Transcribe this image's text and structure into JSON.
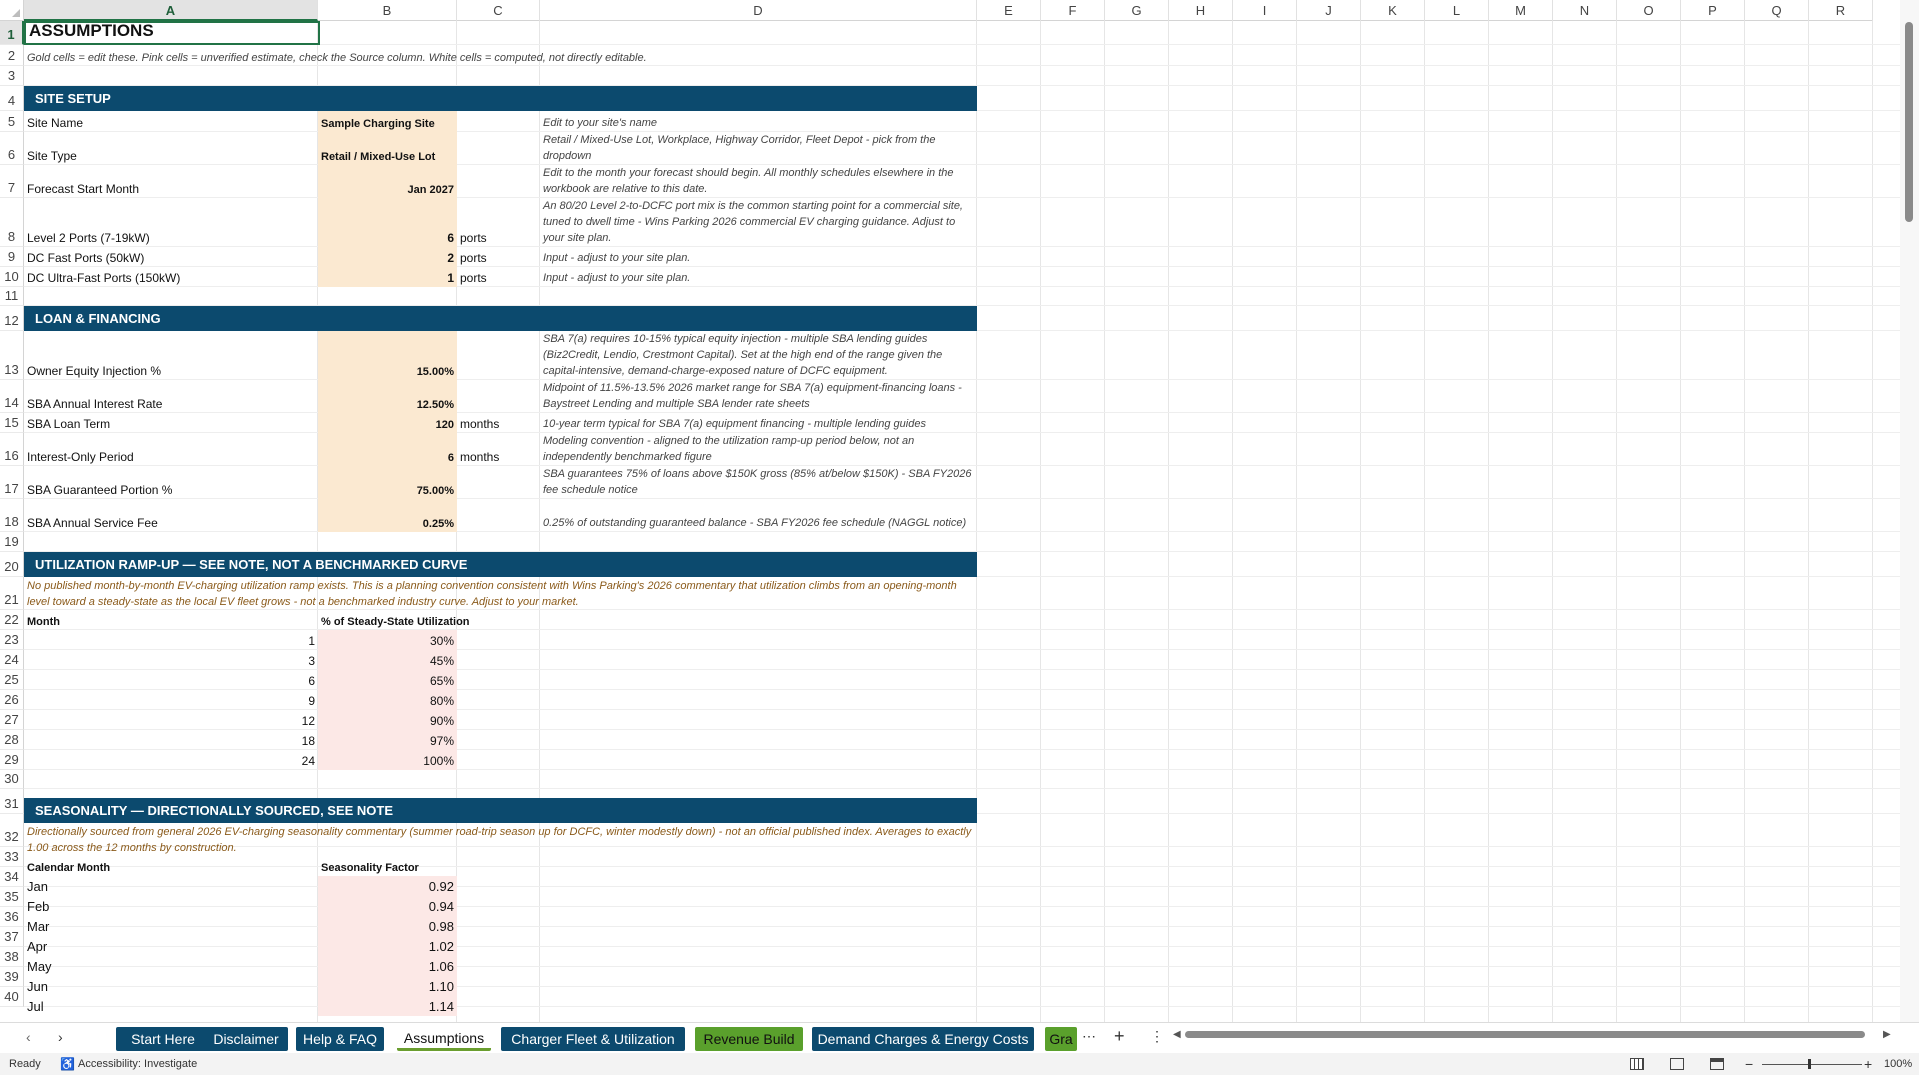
{
  "columns": [
    "A",
    "B",
    "C",
    "D",
    "E",
    "F",
    "G",
    "H",
    "I",
    "J",
    "K",
    "L",
    "M",
    "N",
    "O",
    "P",
    "Q",
    "R"
  ],
  "rows": [
    "1",
    "2",
    "3",
    "4",
    "5",
    "6",
    "7",
    "8",
    "9",
    "10",
    "11",
    "12",
    "13",
    "14",
    "15",
    "16",
    "17",
    "18",
    "19",
    "20",
    "21",
    "22",
    "23",
    "24",
    "25",
    "26",
    "27",
    "28",
    "29",
    "30",
    "31",
    "32",
    "33",
    "34",
    "35",
    "36",
    "37",
    "38",
    "39",
    "40"
  ],
  "title": "ASSUMPTIONS",
  "subtitle": "Gold cells = edit these. Pink cells = unverified estimate, check the Source column. White cells = computed, not directly editable.",
  "site": {
    "header": "SITE SETUP",
    "name_label": "Site Name",
    "name_value": "Sample Charging Site",
    "name_note": "Edit to your site's name",
    "type_label": "Site Type",
    "type_value": "Retail / Mixed-Use Lot",
    "type_note": "Retail / Mixed-Use Lot, Workplace, Highway Corridor, Fleet Depot - pick from the dropdown",
    "start_label": "Forecast Start Month",
    "start_value": "Jan 2027",
    "start_note": "Edit to the month your forecast should begin. All monthly schedules elsewhere in the workbook are relative to this date.",
    "l2_label": "Level 2 Ports (7-19kW)",
    "l2_value": "6",
    "l2_unit": "ports",
    "l2_note": "An 80/20 Level 2-to-DCFC port mix is the common starting point for a commercial site, tuned to dwell time - Wins Parking 2026 commercial EV charging guidance. Adjust to your site plan.",
    "dcf_label": "DC Fast Ports (50kW)",
    "dcf_value": "2",
    "dcf_unit": "ports",
    "dcf_note": "Input - adjust to your site plan.",
    "dcu_label": "DC Ultra-Fast Ports (150kW)",
    "dcu_value": "1",
    "dcu_unit": "ports",
    "dcu_note": "Input - adjust to your site plan."
  },
  "loan": {
    "header": "LOAN & FINANCING",
    "equity_label": "Owner Equity Injection %",
    "equity_value": "15.00%",
    "equity_note": "SBA 7(a) requires 10-15% typical equity injection - multiple SBA lending guides (Biz2Credit, Lendio, Crestmont Capital). Set at the high end of the range given the capital-intensive, demand-charge-exposed nature of DCFC equipment.",
    "rate_label": "SBA Annual Interest Rate",
    "rate_value": "12.50%",
    "rate_note": "Midpoint of 11.5%-13.5% 2026 market range for SBA 7(a) equipment-financing loans - Baystreet Lending and multiple SBA lender rate sheets",
    "term_label": "SBA Loan Term",
    "term_value": "120",
    "term_unit": "months",
    "term_note": "10-year term typical for SBA 7(a) equipment financing - multiple lending guides",
    "io_label": "Interest-Only Period",
    "io_value": "6",
    "io_unit": "months",
    "io_note": "Modeling convention - aligned to the utilization ramp-up period below, not an independently benchmarked figure",
    "guar_label": "SBA Guaranteed Portion %",
    "guar_value": "75.00%",
    "guar_note": "SBA guarantees 75% of loans above $150K gross (85% at/below $150K) - SBA FY2026 fee schedule notice",
    "fee_label": "SBA Annual Service Fee",
    "fee_value": "0.25%",
    "fee_note": "0.25% of outstanding guaranteed balance - SBA FY2026 fee schedule (NAGGL notice)"
  },
  "ramp": {
    "header": "UTILIZATION RAMP-UP  —  SEE NOTE, NOT A BENCHMARKED CURVE",
    "note": "No published month-by-month EV-charging utilization ramp exists. This is a planning convention consistent with Wins Parking's 2026 commentary that utilization climbs from an opening-month level toward a steady-state as the local EV fleet grows - not a benchmarked industry curve. Adjust to your market.",
    "col_month": "Month",
    "col_pct": "% of Steady-State Utilization",
    "rows": [
      {
        "month": "1",
        "pct": "30%"
      },
      {
        "month": "3",
        "pct": "45%"
      },
      {
        "month": "6",
        "pct": "65%"
      },
      {
        "month": "9",
        "pct": "80%"
      },
      {
        "month": "12",
        "pct": "90%"
      },
      {
        "month": "18",
        "pct": "97%"
      },
      {
        "month": "24",
        "pct": "100%"
      }
    ]
  },
  "season": {
    "header": "SEASONALITY  —  DIRECTIONALLY SOURCED, SEE NOTE",
    "note": "Directionally sourced from general 2026 EV-charging seasonality commentary (summer road-trip season up for DCFC, winter modestly down) - not an official published index. Averages to exactly 1.00 across the 12 months by construction.",
    "col_month": "Calendar Month",
    "col_factor": "Seasonality Factor",
    "rows": [
      {
        "month": "Jan",
        "factor": "0.92"
      },
      {
        "month": "Feb",
        "factor": "0.94"
      },
      {
        "month": "Mar",
        "factor": "0.98"
      },
      {
        "month": "Apr",
        "factor": "1.02"
      },
      {
        "month": "May",
        "factor": "1.06"
      },
      {
        "month": "Jun",
        "factor": "1.10"
      },
      {
        "month": "Jul",
        "factor": "1.14"
      }
    ]
  },
  "tabs": {
    "start_here": "Start Here",
    "disclaimer": "Disclaimer",
    "help": "Help & FAQ",
    "assumptions": "Assumptions",
    "fleet": "Charger Fleet & Utilization",
    "revenue": "Revenue Build",
    "demand": "Demand Charges & Energy Costs",
    "partial": "Gra"
  },
  "status": {
    "ready": "Ready",
    "accessibility": "Accessibility: Investigate",
    "zoom": "100%"
  },
  "colors": {
    "header_bar": "#0c4a6e",
    "gold_cell": "#fbe9d1",
    "pink_cell": "#fce8e6",
    "green_tab": "#5aa02c"
  }
}
